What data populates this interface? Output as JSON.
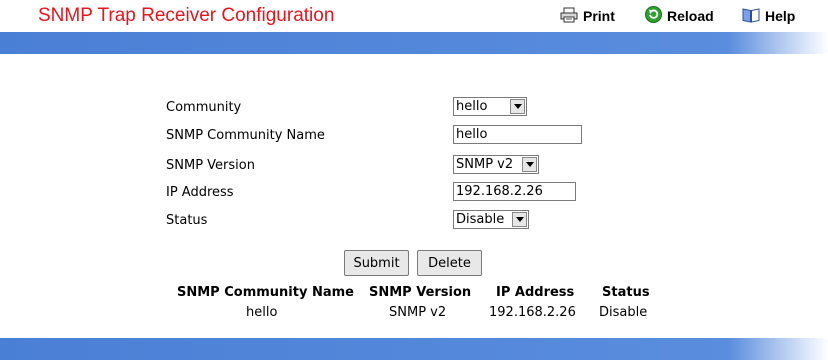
{
  "header": {
    "title": "SNMP Trap Receiver Configuration",
    "print_label": "Print",
    "reload_label": "Reload",
    "help_label": "Help"
  },
  "form": {
    "community": {
      "label": "Community",
      "value": "hello"
    },
    "community_name": {
      "label": "SNMP Community Name",
      "value": "hello"
    },
    "snmp_version": {
      "label": "SNMP Version",
      "value": "SNMP v2"
    },
    "ip_address": {
      "label": "IP Address",
      "value": "192.168.2.26"
    },
    "status": {
      "label": "Status",
      "value": "Disable"
    }
  },
  "buttons": {
    "submit_label": "Submit",
    "delete_label": "Delete"
  },
  "table": {
    "headers": [
      "SNMP Community Name",
      "SNMP Version",
      "IP Address",
      "Status"
    ],
    "rows": [
      [
        "hello",
        "SNMP v2",
        "192.168.2.26",
        "Disable"
      ]
    ]
  },
  "colors": {
    "title": "#e8141c",
    "bar": "#5a8ddd"
  },
  "icons": {
    "print": "printer-icon",
    "reload": "reload-icon",
    "help": "help-book-icon"
  }
}
